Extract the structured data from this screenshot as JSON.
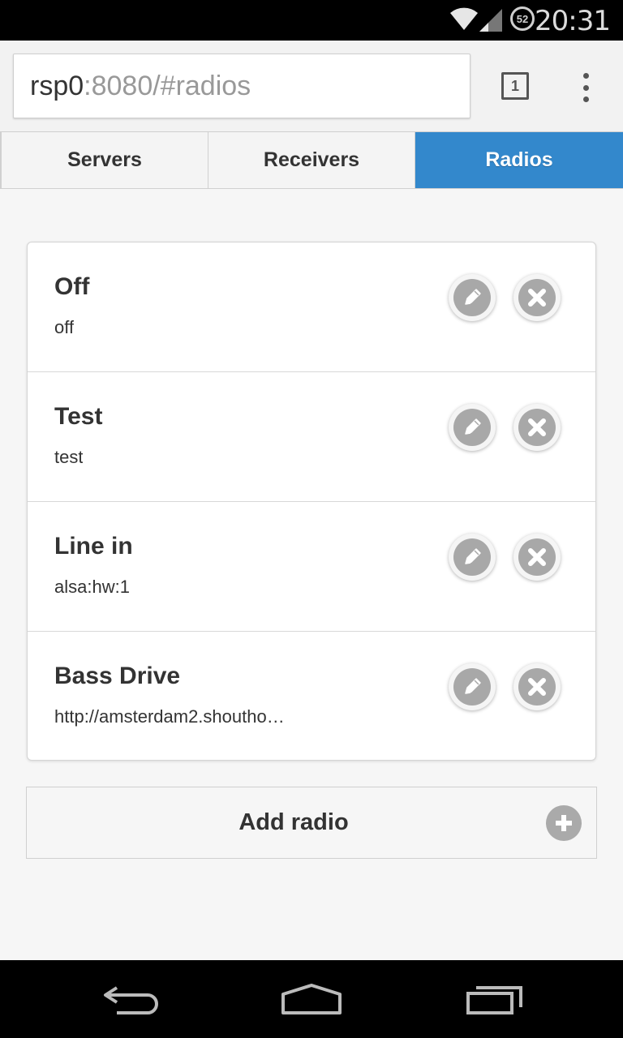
{
  "status_bar": {
    "time": "20:31",
    "battery_level": "52",
    "icons": [
      "wifi-icon",
      "cell-signal-icon",
      "battery-icon"
    ]
  },
  "browser": {
    "url_host": "rsp0",
    "url_rest": ":8080/#radios",
    "tab_count": "1",
    "icons": [
      "tab-switcher-icon",
      "overflow-menu-icon"
    ]
  },
  "tabs": [
    {
      "label": "Servers",
      "active": false
    },
    {
      "label": "Receivers",
      "active": false
    },
    {
      "label": "Radios",
      "active": true
    }
  ],
  "radios": [
    {
      "name": "Off",
      "address": "off"
    },
    {
      "name": "Test",
      "address": "test"
    },
    {
      "name": "Line in",
      "address": "alsa:hw:1"
    },
    {
      "name": "Bass Drive",
      "address": "http://amsterdam2.shoutho…"
    }
  ],
  "add_button": {
    "label": "Add radio",
    "icon": "plus-icon"
  },
  "colors": {
    "accent": "#3388cc",
    "icon_gray": "#a8a8a8"
  },
  "nav_bar": {
    "icons": [
      "back-icon",
      "home-icon",
      "recent-apps-icon"
    ]
  }
}
